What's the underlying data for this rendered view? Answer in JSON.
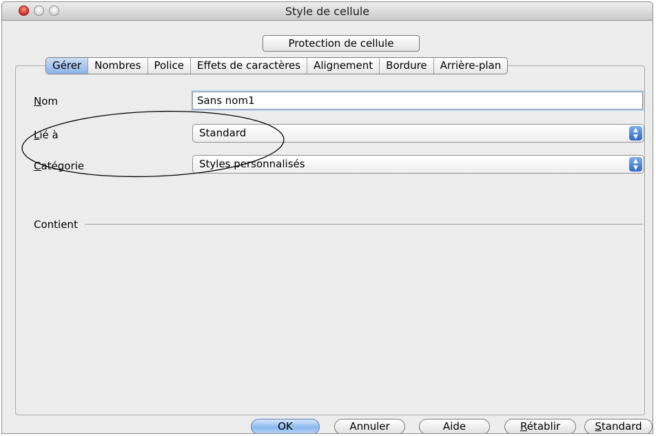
{
  "window": {
    "title": "Style de cellule"
  },
  "tabs_top": {
    "label": "Protection de cellule"
  },
  "tabs": [
    {
      "label": "Gérer",
      "active": true
    },
    {
      "label": "Nombres"
    },
    {
      "label": "Police"
    },
    {
      "label": "Effets de caractères"
    },
    {
      "label": "Alignement"
    },
    {
      "label": "Bordure"
    },
    {
      "label": "Arrière-plan"
    }
  ],
  "form": {
    "name_label_first": "N",
    "name_label_rest": "om",
    "name_value": "Sans nom1",
    "linked_label_first": "L",
    "linked_label_rest": "ié à",
    "linked_value": "Standard",
    "category_label_first": "C",
    "category_label_rest": "atégorie",
    "category_value": "Styles personnalisés"
  },
  "contains": {
    "label": "Contient"
  },
  "buttons": {
    "ok": "OK",
    "cancel": "Annuler",
    "help": "Aide",
    "reset_first": "R",
    "reset_rest": "établir",
    "standard_first": "S",
    "standard_rest": "tandard"
  },
  "icons": {
    "select_stepper": "up-down-arrows-icon"
  },
  "colors": {
    "accent": "#2c68c5",
    "close_light": "#d8312a"
  }
}
